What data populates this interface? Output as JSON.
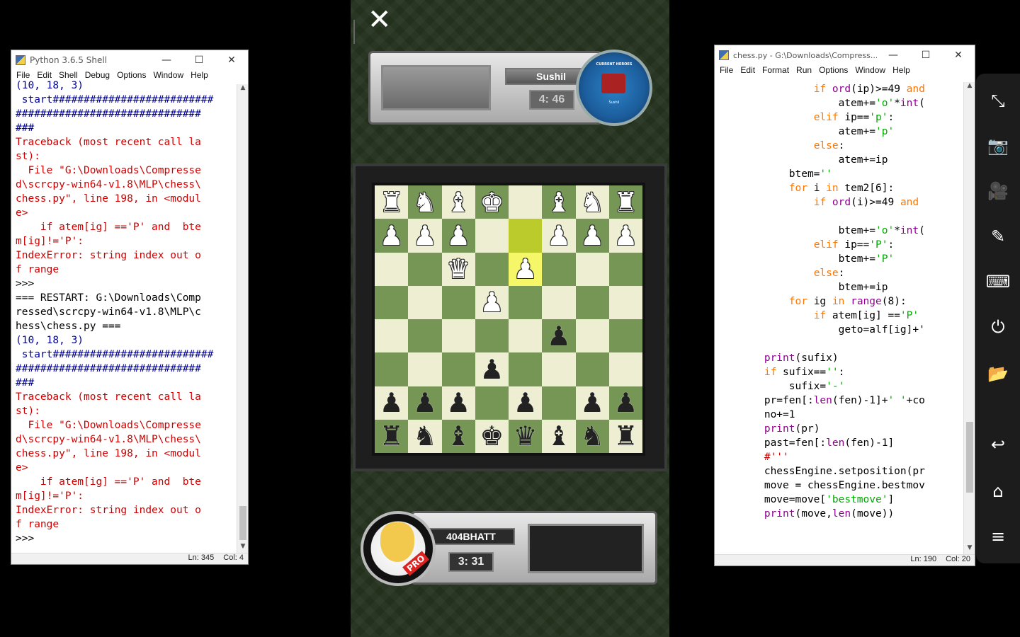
{
  "shell": {
    "title": "Python 3.6.5 Shell",
    "menu": [
      "File",
      "Edit",
      "Shell",
      "Debug",
      "Options",
      "Window",
      "Help"
    ],
    "lines": [
      {
        "t": "(10, 18, 3)",
        "c": "blue"
      },
      {
        "t": " start##########################",
        "c": "blue"
      },
      {
        "t": "##############################",
        "c": "blue"
      },
      {
        "t": "###",
        "c": "blue"
      },
      {
        "t": "Traceback (most recent call la",
        "c": "red"
      },
      {
        "t": "st):",
        "c": "red"
      },
      {
        "t": "  File \"G:\\Downloads\\Compresse",
        "c": "red"
      },
      {
        "t": "d\\scrcpy-win64-v1.8\\MLP\\chess\\",
        "c": "red"
      },
      {
        "t": "chess.py\", line 198, in <modul",
        "c": "red"
      },
      {
        "t": "e>",
        "c": "red"
      },
      {
        "t": "    if atem[ig] =='P' and  bte",
        "c": "red"
      },
      {
        "t": "m[ig]!='P':",
        "c": "red"
      },
      {
        "t": "IndexError: string index out o",
        "c": "red"
      },
      {
        "t": "f range",
        "c": "red"
      },
      {
        "t": ">>>",
        "c": "blk"
      },
      {
        "t": "=== RESTART: G:\\Downloads\\Comp",
        "c": "blk"
      },
      {
        "t": "ressed\\scrcpy-win64-v1.8\\MLP\\c",
        "c": "blk"
      },
      {
        "t": "hess\\chess.py ===",
        "c": "blk"
      },
      {
        "t": "(10, 18, 3)",
        "c": "blue"
      },
      {
        "t": " start##########################",
        "c": "blue"
      },
      {
        "t": "##############################",
        "c": "blue"
      },
      {
        "t": "###",
        "c": "blue"
      },
      {
        "t": "Traceback (most recent call la",
        "c": "red"
      },
      {
        "t": "st):",
        "c": "red"
      },
      {
        "t": "  File \"G:\\Downloads\\Compresse",
        "c": "red"
      },
      {
        "t": "d\\scrcpy-win64-v1.8\\MLP\\chess\\",
        "c": "red"
      },
      {
        "t": "chess.py\", line 198, in <modul",
        "c": "red"
      },
      {
        "t": "e>",
        "c": "red"
      },
      {
        "t": "    if atem[ig] =='P' and  bte",
        "c": "red"
      },
      {
        "t": "m[ig]!='P':",
        "c": "red"
      },
      {
        "t": "IndexError: string index out o",
        "c": "red"
      },
      {
        "t": "f range",
        "c": "red"
      },
      {
        "t": ">>>",
        "c": "blk"
      }
    ],
    "status_ln": "Ln: 345",
    "status_col": "Col: 4"
  },
  "editor": {
    "title": "chess.py - G:\\Downloads\\Compress...",
    "menu": [
      "File",
      "Edit",
      "Format",
      "Run",
      "Options",
      "Window",
      "Help"
    ],
    "lines": [
      [
        [
          "                ",
          "blk"
        ],
        [
          "if",
          "kw"
        ],
        [
          " ",
          "blk"
        ],
        [
          "ord",
          "bi"
        ],
        [
          "(ip)>=49 ",
          "blk"
        ],
        [
          "and",
          "kw"
        ]
      ],
      [
        [
          "                    atem+=",
          "blk"
        ],
        [
          "'o'",
          "str"
        ],
        [
          "*",
          "blk"
        ],
        [
          "int",
          "bi"
        ],
        [
          "(",
          "blk"
        ]
      ],
      [
        [
          "                ",
          "blk"
        ],
        [
          "elif",
          "kw"
        ],
        [
          " ip==",
          "blk"
        ],
        [
          "'p'",
          "str"
        ],
        [
          ":",
          "blk"
        ]
      ],
      [
        [
          "                    atem+=",
          "blk"
        ],
        [
          "'p'",
          "str"
        ]
      ],
      [
        [
          "                ",
          "blk"
        ],
        [
          "else",
          "kw"
        ],
        [
          ":",
          "blk"
        ]
      ],
      [
        [
          "                    atem+=ip",
          "blk"
        ]
      ],
      [
        [
          "            btem=",
          "blk"
        ],
        [
          "''",
          "str"
        ]
      ],
      [
        [
          "            ",
          "blk"
        ],
        [
          "for",
          "kw"
        ],
        [
          " i ",
          "blk"
        ],
        [
          "in",
          "kw"
        ],
        [
          " tem2[6]:",
          "blk"
        ]
      ],
      [
        [
          "                ",
          "blk"
        ],
        [
          "if",
          "kw"
        ],
        [
          " ",
          "blk"
        ],
        [
          "ord",
          "bi"
        ],
        [
          "(i)>=49 ",
          "blk"
        ],
        [
          "and",
          "kw"
        ]
      ],
      [
        [
          "",
          "blk"
        ]
      ],
      [
        [
          "                    btem+=",
          "blk"
        ],
        [
          "'o'",
          "str"
        ],
        [
          "*",
          "blk"
        ],
        [
          "int",
          "bi"
        ],
        [
          "(",
          "blk"
        ]
      ],
      [
        [
          "                ",
          "blk"
        ],
        [
          "elif",
          "kw"
        ],
        [
          " ip==",
          "blk"
        ],
        [
          "'P'",
          "str"
        ],
        [
          ":",
          "blk"
        ]
      ],
      [
        [
          "                    btem+=",
          "blk"
        ],
        [
          "'P'",
          "str"
        ]
      ],
      [
        [
          "                ",
          "blk"
        ],
        [
          "else",
          "kw"
        ],
        [
          ":",
          "blk"
        ]
      ],
      [
        [
          "                    btem+=ip",
          "blk"
        ]
      ],
      [
        [
          "            ",
          "blk"
        ],
        [
          "for",
          "kw"
        ],
        [
          " ig ",
          "blk"
        ],
        [
          "in",
          "kw"
        ],
        [
          " ",
          "blk"
        ],
        [
          "range",
          "bi"
        ],
        [
          "(8):",
          "blk"
        ]
      ],
      [
        [
          "                ",
          "blk"
        ],
        [
          "if",
          "kw"
        ],
        [
          " atem[ig] ==",
          "blk"
        ],
        [
          "'P'",
          "str"
        ]
      ],
      [
        [
          "                    geto=alf[ig]+'",
          "blk"
        ]
      ],
      [
        [
          "",
          "blk"
        ]
      ],
      [
        [
          "        ",
          "blk"
        ],
        [
          "print",
          "bi"
        ],
        [
          "(sufix)",
          "blk"
        ]
      ],
      [
        [
          "        ",
          "blk"
        ],
        [
          "if",
          "kw"
        ],
        [
          " sufix==",
          "blk"
        ],
        [
          "''",
          "str"
        ],
        [
          ":",
          "blk"
        ]
      ],
      [
        [
          "            sufix=",
          "blk"
        ],
        [
          "'-'",
          "str"
        ]
      ],
      [
        [
          "        pr=fen[:",
          "blk"
        ],
        [
          "len",
          "bi"
        ],
        [
          "(fen)-1]+",
          "blk"
        ],
        [
          "' '",
          "str"
        ],
        [
          "+co",
          "blk"
        ]
      ],
      [
        [
          "        no+=1",
          "blk"
        ]
      ],
      [
        [
          "        ",
          "blk"
        ],
        [
          "print",
          "bi"
        ],
        [
          "(pr)",
          "blk"
        ]
      ],
      [
        [
          "        past=fen[:",
          "blk"
        ],
        [
          "len",
          "bi"
        ],
        [
          "(fen)-1]",
          "blk"
        ]
      ],
      [
        [
          "        ",
          "blk"
        ],
        [
          "#'''",
          "red"
        ]
      ],
      [
        [
          "        chessEngine.setposition(pr",
          "blk"
        ]
      ],
      [
        [
          "        move = chessEngine.bestmov",
          "blk"
        ]
      ],
      [
        [
          "        move=move[",
          "blk"
        ],
        [
          "'bestmove'",
          "str"
        ],
        [
          "]",
          "blk"
        ]
      ],
      [
        [
          "        ",
          "blk"
        ],
        [
          "print",
          "bi"
        ],
        [
          "(move,",
          "blk"
        ],
        [
          "len",
          "bi"
        ],
        [
          "(move))",
          "blk"
        ]
      ]
    ],
    "status_ln": "Ln: 190",
    "status_col": "Col: 20"
  },
  "game": {
    "close_glyph": "✕",
    "opponent": {
      "name": "Sushil",
      "time": "4: 46",
      "badge_top": "CURRENT HEROES",
      "badge_name": "Sushil"
    },
    "player": {
      "name": "404BHATT",
      "time": "3: 31",
      "badge": "PRO"
    },
    "board": [
      [
        "wR",
        "wN",
        "wB",
        "wK",
        "",
        "wB",
        "wN",
        "wR"
      ],
      [
        "wP",
        "wP",
        "wP",
        "",
        "",
        "wP",
        "wP",
        "wP"
      ],
      [
        "",
        "",
        "wQ",
        "",
        "wP",
        "",
        "",
        ""
      ],
      [
        "",
        "",
        "",
        "wP",
        "",
        "",
        "",
        ""
      ],
      [
        "",
        "",
        "",
        "",
        "",
        "bP",
        "",
        ""
      ],
      [
        "",
        "",
        "",
        "bP",
        "",
        "",
        "",
        ""
      ],
      [
        "bP",
        "bP",
        "bP",
        "",
        "bP",
        "",
        "bP",
        "bP"
      ],
      [
        "bR",
        "bN",
        "bB",
        "bK",
        "bQ",
        "bB",
        "bN",
        "bR"
      ]
    ],
    "highlight": [
      [
        1,
        4
      ],
      [
        2,
        4
      ]
    ]
  },
  "sidebar": {
    "icons": [
      "fullscreen-exit-icon",
      "camera-icon",
      "video-record-icon",
      "pen-icon",
      "keyboard-icon",
      "power-icon",
      "folder-icon",
      "back-icon",
      "home-icon",
      "menu-icon"
    ]
  }
}
